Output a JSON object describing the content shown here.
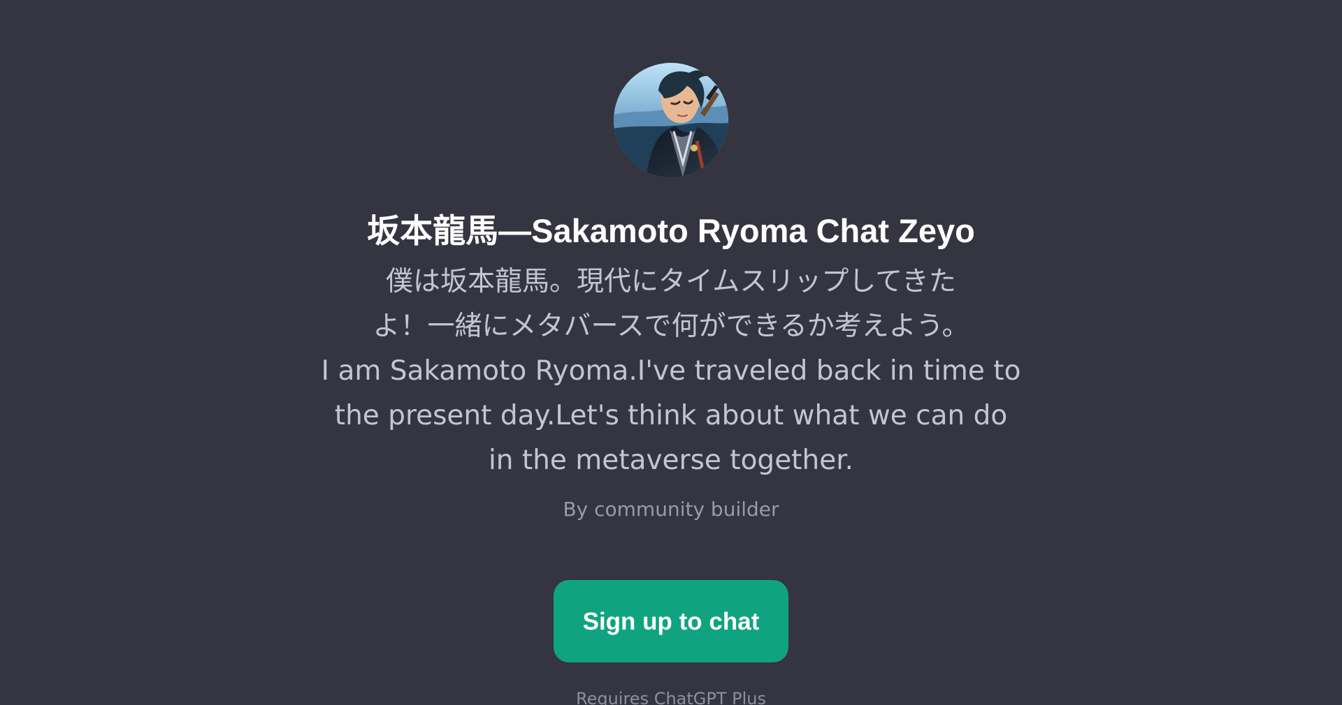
{
  "profile": {
    "avatar": "anime-samurai-avatar",
    "title": "坂本龍馬—Sakamoto Ryoma Chat Zeyo",
    "description": "僕は坂本龍馬。現代にタイムスリップしてきた\nよ！一緒にメタバースで何ができるか考えよう。\nI am Sakamoto Ryoma.I've traveled back in time to\nthe present day.Let's think about what we can do\nin the metaverse together.",
    "author": "By community builder"
  },
  "actions": {
    "signup_label": "Sign up to chat"
  },
  "footer": {
    "text": "Requires ChatGPT Plus"
  },
  "colors": {
    "background": "#343541",
    "button": "#10a37f",
    "title": "#ffffff",
    "description": "#c5c5d2",
    "muted": "#9a9aa8"
  }
}
